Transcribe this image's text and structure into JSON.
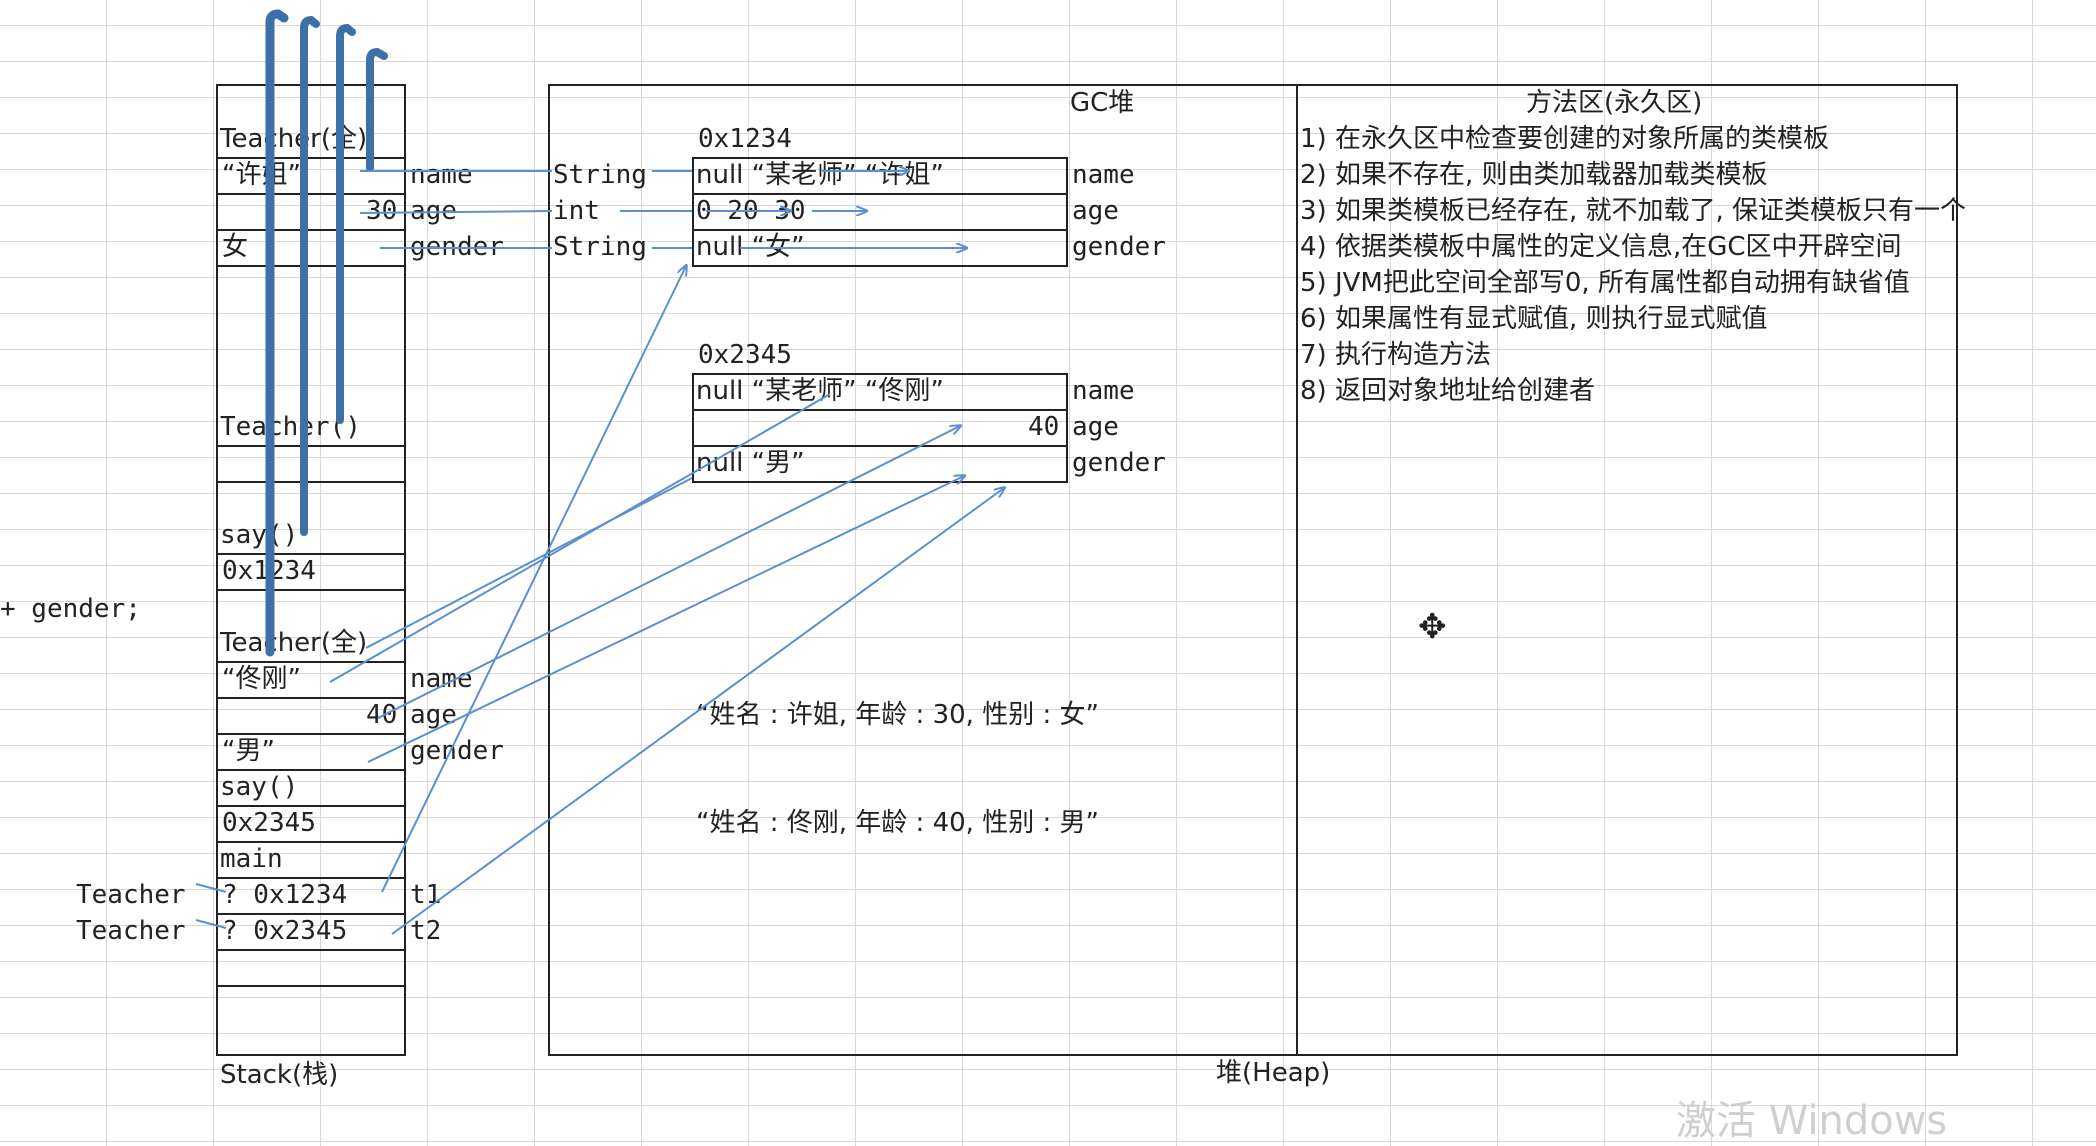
{
  "stack": {
    "label": "Stack(栈)",
    "frames": [
      {
        "name": "Teacher(全)",
        "rows": [
          {
            "value": "“许姐”",
            "field": "name"
          },
          {
            "value": "30",
            "field": "age"
          },
          {
            "value": "女",
            "field": "gender"
          }
        ]
      },
      {
        "name": "Teacher()"
      },
      {
        "name": "say()",
        "value": "0x1234"
      },
      {
        "name": "Teacher(全)",
        "rows": [
          {
            "value": "“佟刚”",
            "field": "name"
          },
          {
            "value": "40",
            "field": "age"
          },
          {
            "value": "“男”",
            "field": "gender"
          }
        ]
      },
      {
        "name": "say()",
        "value": "0x2345"
      },
      {
        "name": "main",
        "vars": [
          {
            "type": "Teacher",
            "value": "?  0x1234",
            "name": "t1"
          },
          {
            "type": "Teacher",
            "value": "?  0x2345",
            "name": "t2"
          }
        ]
      }
    ]
  },
  "left_code_fragment": "+ gender;",
  "field_types": [
    "String",
    "int",
    "String"
  ],
  "heap": {
    "label": "堆(Heap)",
    "gc_label": "GC堆",
    "objects": [
      {
        "address": "0x1234",
        "rows": [
          {
            "value": "null “某老师”  “许姐”",
            "field": "name"
          },
          {
            "value": "0      20     30",
            "field": "age"
          },
          {
            "value": "null           “女”",
            "field": "gender"
          }
        ]
      },
      {
        "address": "0x2345",
        "rows": [
          {
            "value": "null “某老师”  “佟刚”",
            "field": "name"
          },
          {
            "value": "40",
            "field": "age"
          },
          {
            "value": "null           “男”",
            "field": "gender"
          }
        ]
      }
    ],
    "outputs": [
      "“姓名 : 许姐, 年龄 : 30, 性别 : 女”",
      "“姓名 : 佟刚, 年龄 : 40, 性别 : 男”"
    ]
  },
  "method_area": {
    "title": "方法区(永久区)",
    "steps": [
      "1)  在永久区中检查要创建的对象所属的类模板",
      "2)  如果不存在, 则由类加载器加载类模板",
      "3)  如果类模板已经存在, 就不加载了, 保证类模板只有一个",
      "4)  依据类模板中属性的定义信息,在GC区中开辟空间",
      "5)  JVM把此空间全部写0, 所有属性都自动拥有缺省值",
      "6)  如果属性有显式赋值, 则执行显式赋值",
      "7)  执行构造方法",
      "8)  返回对象地址给创建者"
    ]
  },
  "watermark": "激活 Windows",
  "colors": {
    "arrow": "#5b8fd0",
    "stack_bar": "#3d6fa8",
    "border": "#222222",
    "grid": "#d8d8d8"
  }
}
